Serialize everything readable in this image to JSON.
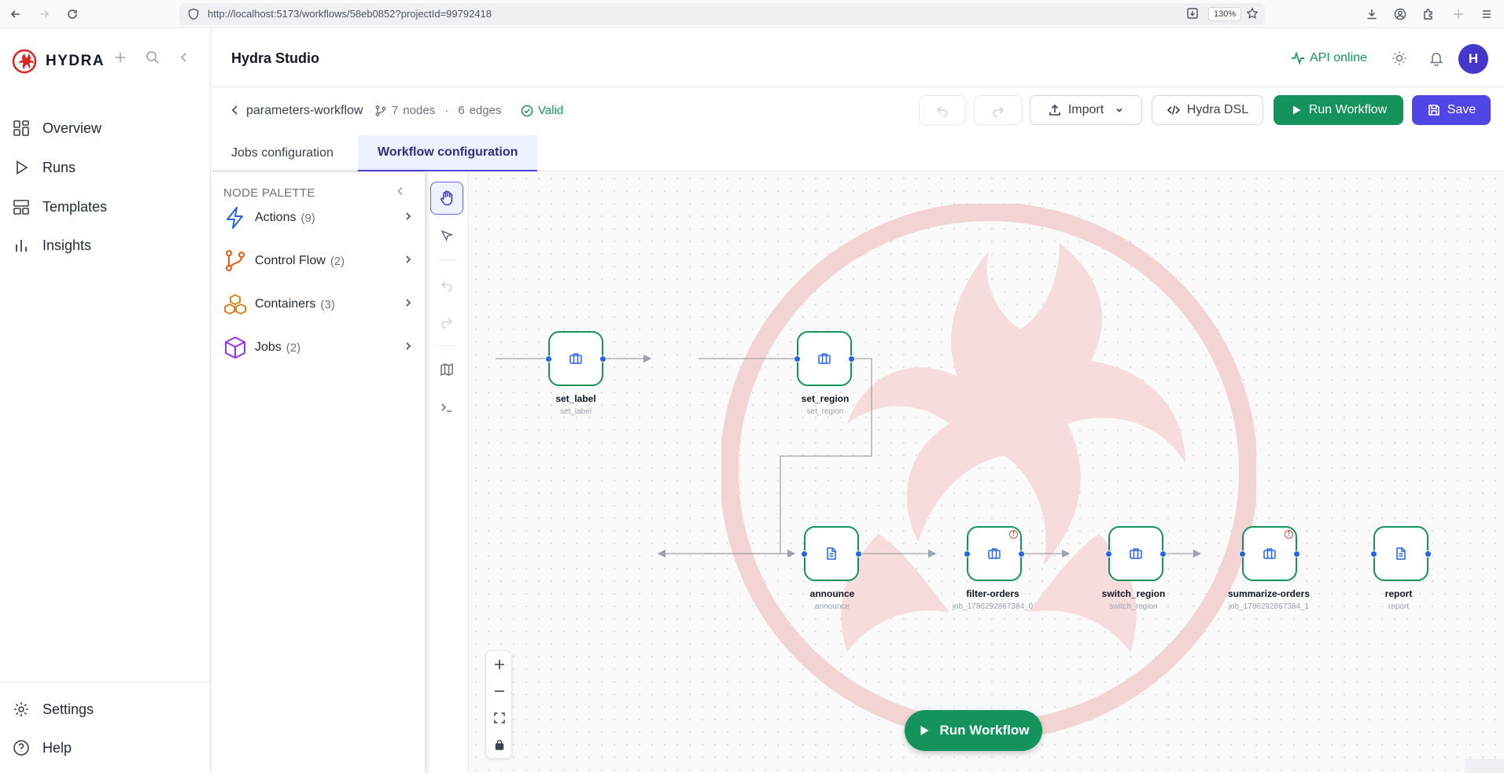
{
  "browser": {
    "url": "http://localhost:5173/workflows/58eb0852?projectId=99792418",
    "zoom": "130%"
  },
  "sidebar": {
    "brand": "HYDRA",
    "nav": [
      {
        "label": "Overview",
        "icon": "grid-icon"
      },
      {
        "label": "Runs",
        "icon": "play-icon"
      },
      {
        "label": "Templates",
        "icon": "layout-icon"
      },
      {
        "label": "Insights",
        "icon": "bar-chart-icon"
      }
    ],
    "footer": [
      {
        "label": "Settings",
        "icon": "gear-icon"
      },
      {
        "label": "Help",
        "icon": "help-icon"
      }
    ]
  },
  "header": {
    "title": "Hydra Studio",
    "api_status": "API online",
    "avatar_initial": "H"
  },
  "toolbar": {
    "workflow_name": "parameters-workflow",
    "nodes_count": "7",
    "nodes_word": "nodes",
    "separator": "·",
    "edges_count": "6",
    "edges_word": "edges",
    "valid_label": "Valid",
    "import_label": "Import",
    "dsl_label": "Hydra DSL",
    "run_label": "Run Workflow",
    "save_label": "Save"
  },
  "tabs": [
    {
      "label": "Jobs configuration",
      "active": false
    },
    {
      "label": "Workflow configuration",
      "active": true
    }
  ],
  "palette": {
    "title": "NODE PALETTE",
    "items": [
      {
        "label": "Actions",
        "count": "(9)",
        "icon": "lightning-icon",
        "color": "#2563eb"
      },
      {
        "label": "Control Flow",
        "count": "(2)",
        "icon": "branch-icon",
        "color": "#ea580c"
      },
      {
        "label": "Containers",
        "count": "(3)",
        "icon": "boxes-icon",
        "color": "#d97706"
      },
      {
        "label": "Jobs",
        "count": "(2)",
        "icon": "cube-icon",
        "color": "#9333ea"
      }
    ]
  },
  "canvas": {
    "nodes": [
      {
        "label": "set_label",
        "sub": "set_label",
        "icon": "briefcase-icon",
        "warning": false
      },
      {
        "label": "set_region",
        "sub": "set_region",
        "icon": "briefcase-icon",
        "warning": false
      },
      {
        "label": "announce",
        "sub": "announce",
        "icon": "document-icon",
        "warning": false
      },
      {
        "label": "filter-orders",
        "sub": "job_1786292867384_0",
        "icon": "briefcase-icon",
        "warning": true
      },
      {
        "label": "switch_region",
        "sub": "switch_region",
        "icon": "briefcase-icon",
        "warning": false
      },
      {
        "label": "summarize-orders",
        "sub": "job_1786292867384_1",
        "icon": "briefcase-icon",
        "warning": true
      },
      {
        "label": "report",
        "sub": "report",
        "icon": "document-icon",
        "warning": false
      }
    ],
    "run_label": "Run Workflow",
    "warning_mark": "!"
  },
  "colors": {
    "accent": "#4f46e5",
    "success": "#15935c",
    "handle": "#2563eb",
    "warning": "#ef4444"
  }
}
